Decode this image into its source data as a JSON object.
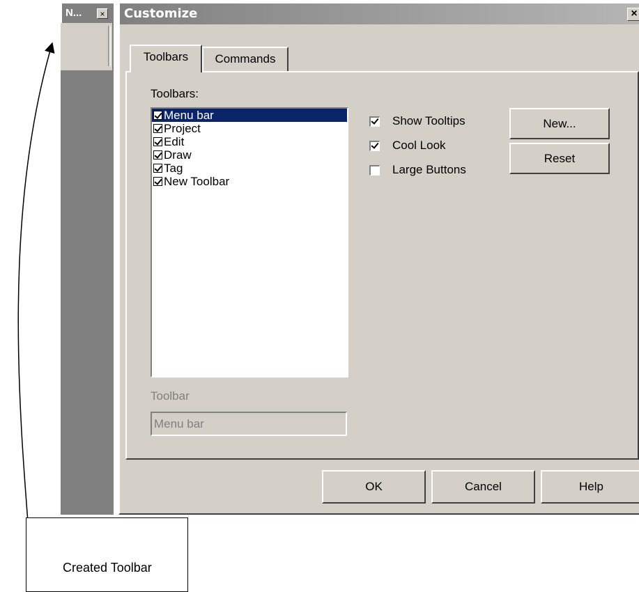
{
  "created_toolbar": {
    "title": "N...",
    "close_glyph": "×"
  },
  "dialog": {
    "title": "Customize",
    "close_glyph": "×",
    "tabs": [
      {
        "label": "Toolbars",
        "active": true
      },
      {
        "label": "Commands",
        "active": false
      }
    ],
    "toolbars_label": "Toolbars:",
    "toolbars_list": [
      {
        "label": "Menu bar",
        "checked": true,
        "selected": true
      },
      {
        "label": "Project",
        "checked": true,
        "selected": false
      },
      {
        "label": "Edit",
        "checked": true,
        "selected": false
      },
      {
        "label": "Draw",
        "checked": true,
        "selected": false
      },
      {
        "label": "Tag",
        "checked": true,
        "selected": false
      },
      {
        "label": "New Toolbar",
        "checked": true,
        "selected": false
      }
    ],
    "options": [
      {
        "label": "Show Tooltips",
        "checked": true
      },
      {
        "label": "Cool Look",
        "checked": true
      },
      {
        "label": "Large Buttons",
        "checked": false
      }
    ],
    "new_button": "New...",
    "reset_button": "Reset",
    "toolbar_name_label": "Toolbar",
    "toolbar_name_value": "Menu bar",
    "ok_button": "OK",
    "cancel_button": "Cancel",
    "help_button": "Help"
  },
  "annotation": {
    "text": "Created Toolbar"
  },
  "colors": {
    "face": "#d4d0c8",
    "selection": "#0a246a",
    "title_inactive": "#808080"
  }
}
